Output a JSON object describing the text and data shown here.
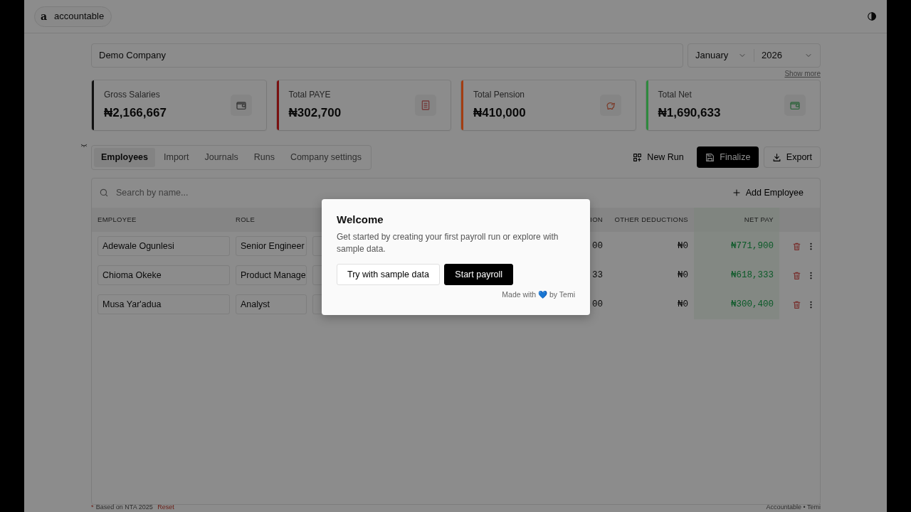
{
  "header": {
    "logo_letter": "a",
    "logo_text": "accountable"
  },
  "company": {
    "value": "Demo Company"
  },
  "period": {
    "month": "January",
    "year": "2026"
  },
  "show_more": "Show more",
  "stats": [
    {
      "label": "Gross Salaries",
      "value": "₦2,166,667",
      "color": "#111111"
    },
    {
      "label": "Total PAYE",
      "value": "₦302,700",
      "color": "#7a1010"
    },
    {
      "label": "Total Pension",
      "value": "₦410,000",
      "color": "#a33d12"
    },
    {
      "label": "Total Net",
      "value": "₦1,690,633",
      "color": "#2e8a3e"
    }
  ],
  "tabs": [
    {
      "label": "Employees",
      "selected": true
    },
    {
      "label": "Import",
      "selected": false
    },
    {
      "label": "Journals",
      "selected": false
    },
    {
      "label": "Runs",
      "selected": false
    },
    {
      "label": "Company settings",
      "selected": false
    }
  ],
  "actions": [
    {
      "label": "New Run",
      "kind": "ghost"
    },
    {
      "label": "Finalize",
      "kind": "dark"
    },
    {
      "label": "Export",
      "kind": "outline"
    }
  ],
  "search": {
    "placeholder": "Search by name..."
  },
  "add_employee": "Add Employee",
  "table": {
    "columns": [
      "EMPLOYEE",
      "ROLE",
      "ION",
      "OTHER DEDUCTIONS",
      "NET PAY"
    ],
    "rows": [
      {
        "employee": "Adewale Ogunlesi",
        "role": "Senior Engineer",
        "column_3": "00",
        "other_deductions": "₦0",
        "net_pay": "₦771,900"
      },
      {
        "employee": "Chioma Okeke",
        "role": "Product Manage",
        "column_3": "33",
        "other_deductions": "₦0",
        "net_pay": "₦618,333"
      },
      {
        "employee": "Musa Yar'adua",
        "role": "Analyst",
        "column_3": "00",
        "other_deductions": "₦0",
        "net_pay": "₦300,400"
      }
    ]
  },
  "modal": {
    "title": "Welcome",
    "text": "Get started by creating your first payroll run or explore with sample data.",
    "secondary": "Try with sample data",
    "primary": "Start payroll",
    "credit_prefix": "Made with",
    "heart": "💙",
    "credit_by": "by",
    "credit_link": "Temi"
  },
  "footer": {
    "asterisk": "*",
    "note": "Based on NTA 2025",
    "reset": "Reset",
    "right": "Accountable • Temi"
  }
}
